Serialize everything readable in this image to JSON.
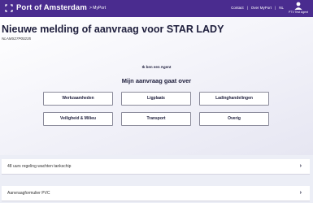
{
  "header": {
    "brand": "Port of Amsterdam",
    "crumb": "> MyPort",
    "links": [
      "Contact",
      "|",
      "Over MyPort",
      "|",
      "NL"
    ],
    "user_name": "PTV Test Agent"
  },
  "page": {
    "title": "Nieuwe melding of aanvraag voor STAR LADY",
    "reference": "NLAMS27P00235",
    "role_text": "Ik ben een Agent",
    "subtitle": "Mijn aanvraag gaat over"
  },
  "options": [
    "Werkzaamheden",
    "Ligplaats",
    "Ladinghandelingen",
    "Veiligheid & Milieu",
    "Transport",
    "Overig"
  ],
  "cards": [
    {
      "label": "48 uurs regeling wachten tankschip",
      "chevron": "›"
    },
    {
      "label": "Aanvraagformulier PVC",
      "chevron": "›"
    }
  ],
  "colors": {
    "brand": "#4a2c8f",
    "background": "#eceef6",
    "text": "#1e1e3c"
  }
}
